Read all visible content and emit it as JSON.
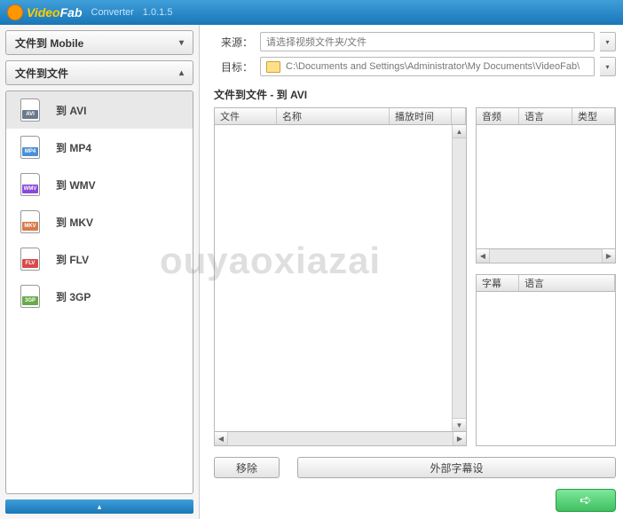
{
  "app": {
    "name_v": "Video",
    "name_f": "Fab",
    "product": "Converter",
    "version": "1.0.1.5"
  },
  "sidebar": {
    "mobile_header": "文件到 Mobile",
    "file_header": "文件到文件",
    "items": [
      {
        "label": "到 AVI",
        "ext": "AVI"
      },
      {
        "label": "到 MP4",
        "ext": "MP4"
      },
      {
        "label": "到 WMV",
        "ext": "WMV"
      },
      {
        "label": "到 MKV",
        "ext": "MKV"
      },
      {
        "label": "到 FLV",
        "ext": "FLV"
      },
      {
        "label": "到 3GP",
        "ext": "3GP"
      }
    ]
  },
  "paths": {
    "source_label": "来源：",
    "target_label": "目标：",
    "source_placeholder": "请选择视频文件夹/文件",
    "target_value": "C:\\Documents and Settings\\Administrator\\My Documents\\VideoFab\\"
  },
  "section_title": "文件到文件 - 到 AVI",
  "left_table": {
    "col_file": "文件",
    "col_name": "名称",
    "col_duration": "播放时间"
  },
  "right_table1": {
    "col_audio": "音频",
    "col_lang": "语言",
    "col_type": "类型"
  },
  "right_table2": {
    "col_sub": "字幕",
    "col_lang": "语言"
  },
  "buttons": {
    "remove": "移除",
    "ext_sub": "外部字幕设"
  },
  "watermark": "ouyaoxiazai"
}
